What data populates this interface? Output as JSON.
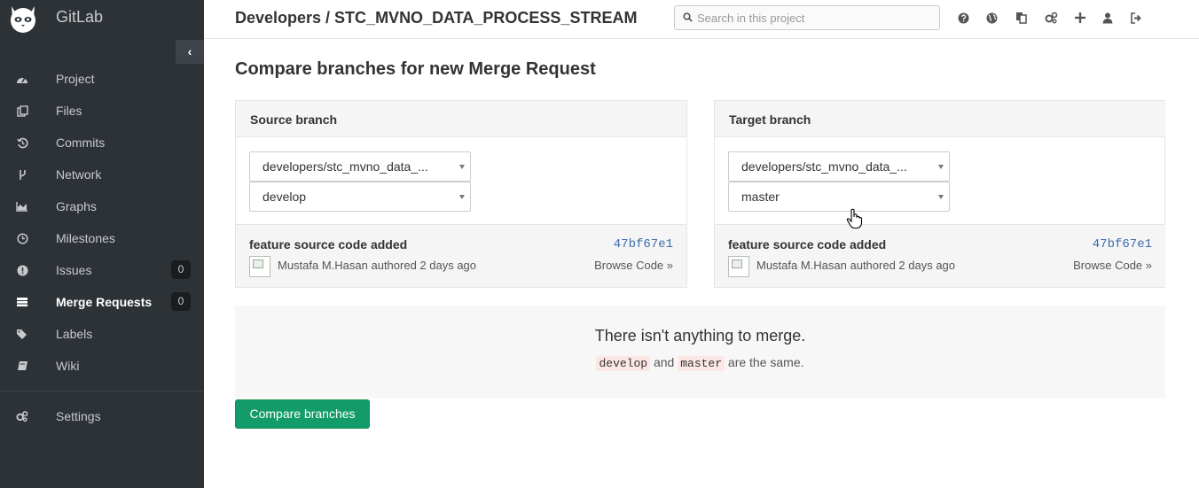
{
  "brand": {
    "name": "GitLab"
  },
  "sidebar": {
    "collapse_glyph": "‹",
    "items": [
      {
        "label": "Project",
        "icon": "dashboard-icon"
      },
      {
        "label": "Files",
        "icon": "files-icon"
      },
      {
        "label": "Commits",
        "icon": "history-icon"
      },
      {
        "label": "Network",
        "icon": "code-fork-icon"
      },
      {
        "label": "Graphs",
        "icon": "area-chart-icon"
      },
      {
        "label": "Milestones",
        "icon": "clock-icon"
      },
      {
        "label": "Issues",
        "icon": "exclamation-circle-icon",
        "badge": "0"
      },
      {
        "label": "Merge Requests",
        "icon": "tasks-icon",
        "badge": "0",
        "active": true
      },
      {
        "label": "Labels",
        "icon": "tags-icon"
      },
      {
        "label": "Wiki",
        "icon": "book-icon"
      }
    ],
    "settings": {
      "label": "Settings",
      "icon": "cogs-icon"
    }
  },
  "header": {
    "title": "Developers / STC_MVNO_DATA_PROCESS_STREAM",
    "search_placeholder": "Search in this project",
    "icons": [
      "help-icon",
      "globe-icon",
      "copy-icon",
      "cogs-icon",
      "plus-icon",
      "user-icon",
      "sign-out-icon"
    ]
  },
  "page": {
    "heading": "Compare branches for new Merge Request",
    "source": {
      "title": "Source branch",
      "project": "developers/stc_mvno_data_...",
      "branch": "develop",
      "commit_message": "feature source code added",
      "commit_sha": "47bf67e1",
      "author": "Mustafa M.Hasan authored 2 days ago",
      "browse": "Browse Code »"
    },
    "target": {
      "title": "Target branch",
      "project": "developers/stc_mvno_data_...",
      "branch": "master",
      "commit_message": "feature source code added",
      "commit_sha": "47bf67e1",
      "author": "Mustafa M.Hasan authored 2 days ago",
      "browse": "Browse Code »"
    },
    "notice": {
      "title": "There isn't anything to merge.",
      "branch_a": "develop",
      "and_text": "and",
      "branch_b": "master",
      "suffix": "are the same."
    },
    "compare_button": "Compare branches"
  },
  "colors": {
    "sidebar_bg": "#2d3237",
    "button_green": "#139c6a",
    "sha_link": "#3c6cad"
  }
}
